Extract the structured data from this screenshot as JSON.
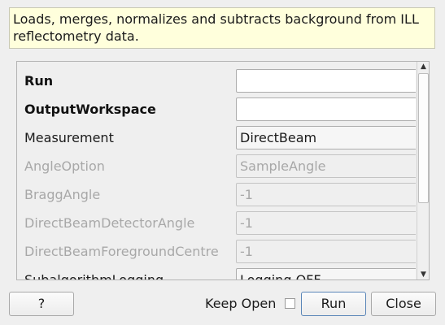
{
  "description": "Loads, merges, normalizes and subtracts background from ILL reflectometry data.",
  "properties": [
    {
      "label": "Run",
      "value": "",
      "style": "bold",
      "widget": "text"
    },
    {
      "label": "OutputWorkspace",
      "value": "",
      "style": "bold",
      "widget": "text"
    },
    {
      "label": "Measurement",
      "value": "DirectBeam",
      "style": "normal",
      "widget": "combo"
    },
    {
      "label": "AngleOption",
      "value": "SampleAngle",
      "style": "disabled",
      "widget": "combo"
    },
    {
      "label": "BraggAngle",
      "value": "-1",
      "style": "disabled",
      "widget": "text"
    },
    {
      "label": "DirectBeamDetectorAngle",
      "value": "-1",
      "style": "disabled",
      "widget": "text"
    },
    {
      "label": "DirectBeamForegroundCentre",
      "value": "-1",
      "style": "disabled",
      "widget": "text"
    },
    {
      "label": "SubalgorithmLogging",
      "value": "Logging OFF",
      "style": "normal",
      "widget": "combo"
    }
  ],
  "scrollbar": {
    "up_icon": "triangle-up",
    "down_icon": "triangle-down"
  },
  "buttons": {
    "help": "?",
    "keep_open": "Keep Open",
    "keep_open_checked": false,
    "run": "Run",
    "close": "Close"
  }
}
